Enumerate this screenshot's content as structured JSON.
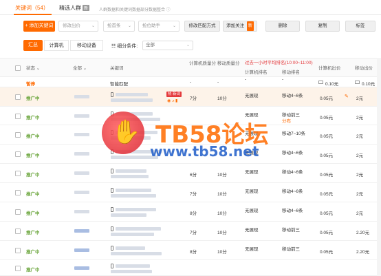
{
  "tabs": {
    "keywords": "关键词（54）",
    "crowd": "精选人群",
    "crowd_badge": "新",
    "note": "人群数据和关键词数据部分数据整合 ⓘ"
  },
  "toolbar": {
    "add_keyword": "+ 添加关键词",
    "filters": [
      "修改出价",
      "抢首条",
      "抢位助手"
    ],
    "match": "修改匹配方式",
    "follow": "添加关注",
    "follow_badge": "新",
    "delete": "删除",
    "copy": "复制",
    "tag": "标签"
  },
  "view": {
    "summary": "汇总",
    "computer": "计算机",
    "mobile": "移动设备",
    "filter_label": "细分条件:",
    "filter_value": "全部"
  },
  "header": {
    "status": "状态",
    "all": "全部",
    "keyword": "关键词",
    "pc_quality": "计算机质量分",
    "mobile_quality": "移动质量分",
    "rank_note": "过去一小时平均排名(10:00~11:00)",
    "pc_rank": "计算机排名",
    "mobile_rank": "移动排名",
    "pc_bid": "计算机出价",
    "mobile_bid": "移动出价"
  },
  "watermark": {
    "title": "TB58论坛",
    "url": "www.tb58.net"
  },
  "rows": [
    {
      "status": "暂停",
      "keyword": "智能匹配",
      "pcq": "-",
      "mq": "-",
      "pcr": "-",
      "mr": "-",
      "pcb": "0.10元",
      "mb": "0.10元"
    },
    {
      "status": "推广中",
      "keyword": "",
      "pcq": "7分",
      "mq": "10分",
      "pcr": "无展现",
      "mr": "移动4~6条",
      "pcb": "0.05元",
      "mb": "2元",
      "badge": "热 新词"
    },
    {
      "status": "推广中",
      "keyword": "",
      "pcq": "",
      "mq": "",
      "pcr": "无展现",
      "mr": "移动前三",
      "mr2": "分布",
      "pcb": "0.05元",
      "mb": "2元"
    },
    {
      "status": "推广中",
      "keyword": "",
      "pcq": "",
      "mq": "",
      "pcr": "无展现",
      "mr": "移动7~10条",
      "pcb": "0.05元",
      "mb": "2元"
    },
    {
      "status": "推广中",
      "keyword": "",
      "pcq": "",
      "mq": "",
      "pcr": "无展现",
      "mr": "移动4~6条",
      "pcb": "0.05元",
      "mb": "2元"
    },
    {
      "status": "推广中",
      "keyword": "",
      "pcq": "6分",
      "mq": "10分",
      "pcr": "无展现",
      "mr": "移动4~6条",
      "pcb": "0.05元",
      "mb": "2元"
    },
    {
      "status": "推广中",
      "keyword": "",
      "pcq": "7分",
      "mq": "10分",
      "pcr": "无展现",
      "mr": "移动4~6条",
      "pcb": "0.05元",
      "mb": "2元"
    },
    {
      "status": "推广中",
      "keyword": "",
      "pcq": "8分",
      "mq": "10分",
      "pcr": "无展现",
      "mr": "移动4~6条",
      "pcb": "0.05元",
      "mb": "2元"
    },
    {
      "status": "推广中",
      "keyword": "",
      "pcq": "7分",
      "mq": "10分",
      "pcr": "无展现",
      "mr": "移动前三",
      "pcb": "0.05元",
      "mb": "2.20元"
    },
    {
      "status": "推广中",
      "keyword": "",
      "pcq": "8分",
      "mq": "10分",
      "pcr": "无展现",
      "mr": "移动前三",
      "pcb": "0.05元",
      "mb": "2.20元"
    },
    {
      "status": "推广中",
      "keyword": "",
      "pcq": "",
      "mq": "",
      "pcr": "",
      "mr": "",
      "pcb": "",
      "mb": ""
    }
  ]
}
